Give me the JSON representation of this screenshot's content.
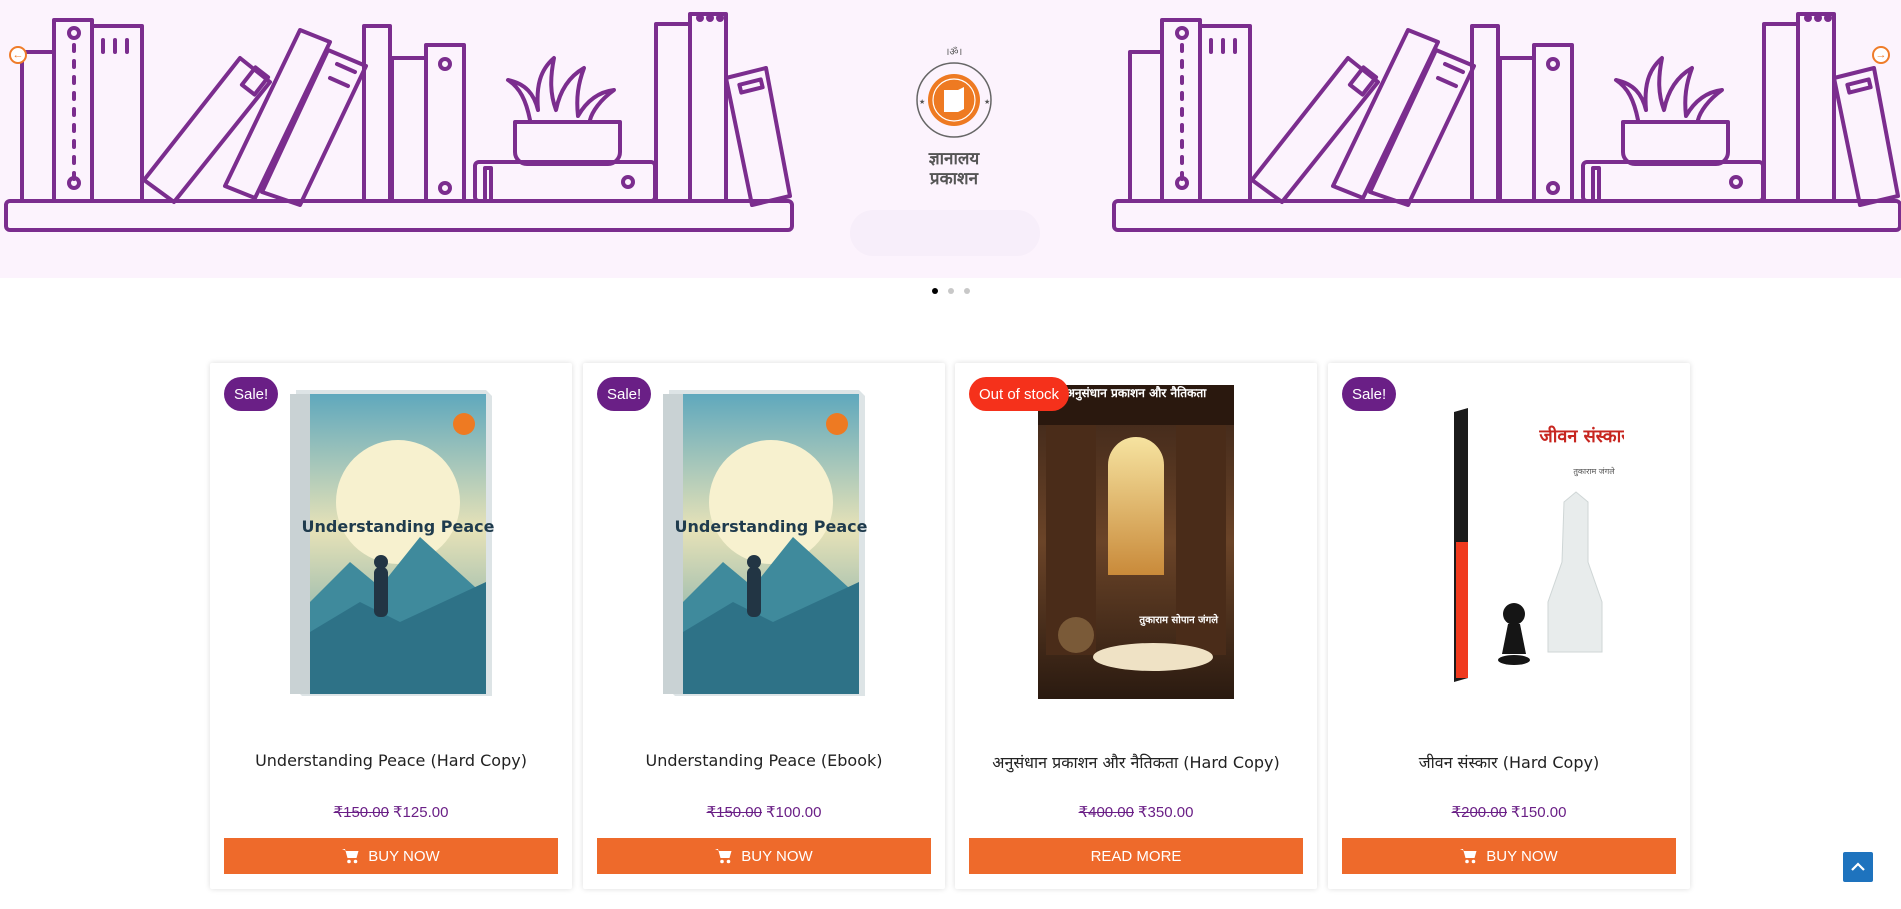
{
  "hero": {
    "logo_top_text": "।ॐ।",
    "logo_seal_text": "ज्ञानालय ज्ञानालय",
    "logo_name_line1": "ज्ञानालय",
    "logo_name_line2": "प्रकाशन",
    "prev_icon": "arrow-left-icon",
    "next_icon": "arrow-right-icon"
  },
  "slider": {
    "dots": 3,
    "active_dot": 0
  },
  "products": [
    {
      "badge": "Sale!",
      "badge_type": "sale",
      "title": "Understanding Peace (Hard Copy)",
      "old_price": "₹150.00",
      "new_price": "₹125.00",
      "button": "BUY NOW",
      "button_icon": "cart-icon",
      "cover_title": "Understanding Peace"
    },
    {
      "badge": "Sale!",
      "badge_type": "sale",
      "title": "Understanding Peace (Ebook)",
      "old_price": "₹150.00",
      "new_price": "₹100.00",
      "button": "BUY NOW",
      "button_icon": "cart-icon",
      "cover_title": "Understanding Peace"
    },
    {
      "badge": "Out of stock",
      "badge_type": "oos",
      "title": "अनुसंधान प्रकाशन और नैतिकता (Hard Copy)",
      "old_price": "₹400.00",
      "new_price": "₹350.00",
      "button": "READ MORE",
      "button_icon": "",
      "cover_title": "अनुसंधान प्रकाशन और नैतिकता",
      "cover_author": "तुकाराम सोपान जंगले"
    },
    {
      "badge": "Sale!",
      "badge_type": "sale",
      "title": "जीवन संस्कार (Hard Copy)",
      "old_price": "₹200.00",
      "new_price": "₹150.00",
      "button": "BUY NOW",
      "button_icon": "cart-icon",
      "cover_title": "जीवन संस्कार",
      "cover_author": "तुकाराम जंगले"
    }
  ],
  "colors": {
    "brand_purple": "#6a1f86",
    "brand_orange": "#ee6a2b",
    "out_of_stock_red": "#f5311b",
    "hero_bg": "#fcf3fd",
    "to_top_blue": "#1e73be"
  },
  "to_top_icon": "chevron-up-icon"
}
